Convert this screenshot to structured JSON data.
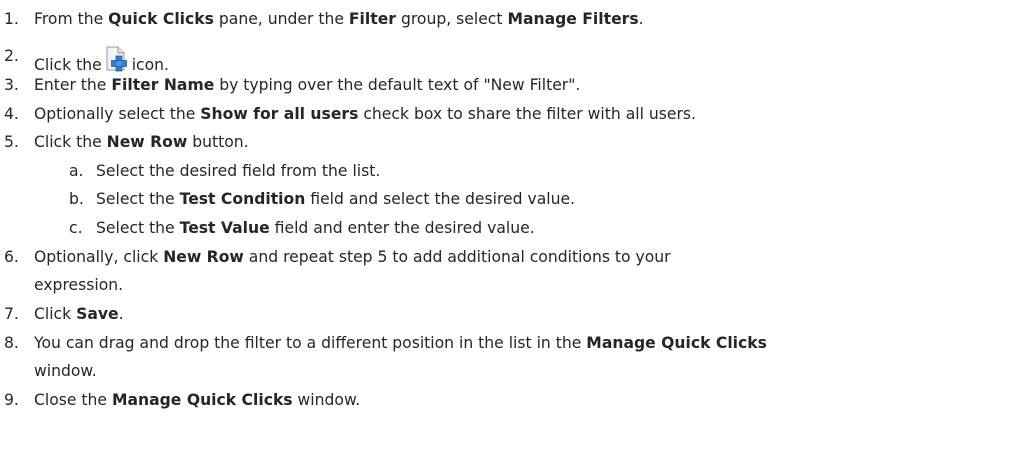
{
  "steps": [
    {
      "num": "1.",
      "parts": [
        "From the ",
        "Quick Clicks",
        " pane, under the ",
        "Filter",
        " group, select ",
        "Manage Filters",
        "."
      ]
    },
    {
      "num": "2.",
      "before": "Click the",
      "icon": "new-filter-icon",
      "after": "icon."
    },
    {
      "num": "3.",
      "parts": [
        "Enter the ",
        "Filter Name",
        " by typing over the default text of \"New Filter\"."
      ]
    },
    {
      "num": "4.",
      "parts": [
        "Optionally select the ",
        "Show for all users",
        " check box to share the filter with all users."
      ]
    },
    {
      "num": "5.",
      "parts": [
        "Click the ",
        "New Row",
        " button."
      ]
    },
    {
      "num": "a.",
      "text": "Select the desired field from the list."
    },
    {
      "num": "b.",
      "parts": [
        "Select the ",
        "Test Condition",
        " field and select the desired value."
      ]
    },
    {
      "num": "c.",
      "parts": [
        "Select the ",
        "Test Value",
        " field and enter the desired value."
      ]
    },
    {
      "num": "6.",
      "parts": [
        "Optionally, click ",
        "New Row",
        " and repeat step 5 to add additional conditions to your"
      ],
      "cont": "expression."
    },
    {
      "num": "7.",
      "parts": [
        "Click ",
        "Save",
        "."
      ]
    },
    {
      "num": "8.",
      "parts": [
        "You can drag and drop the filter to a different position in the list in the ",
        "Manage Quick Clicks"
      ],
      "cont": "window."
    },
    {
      "num": "9.",
      "parts": [
        "Close the ",
        "Manage Quick Clicks",
        " window."
      ]
    }
  ],
  "colors": {
    "text": "#262626",
    "icon_page": "#f4f4f4",
    "icon_plus": "#2f7fd0"
  }
}
